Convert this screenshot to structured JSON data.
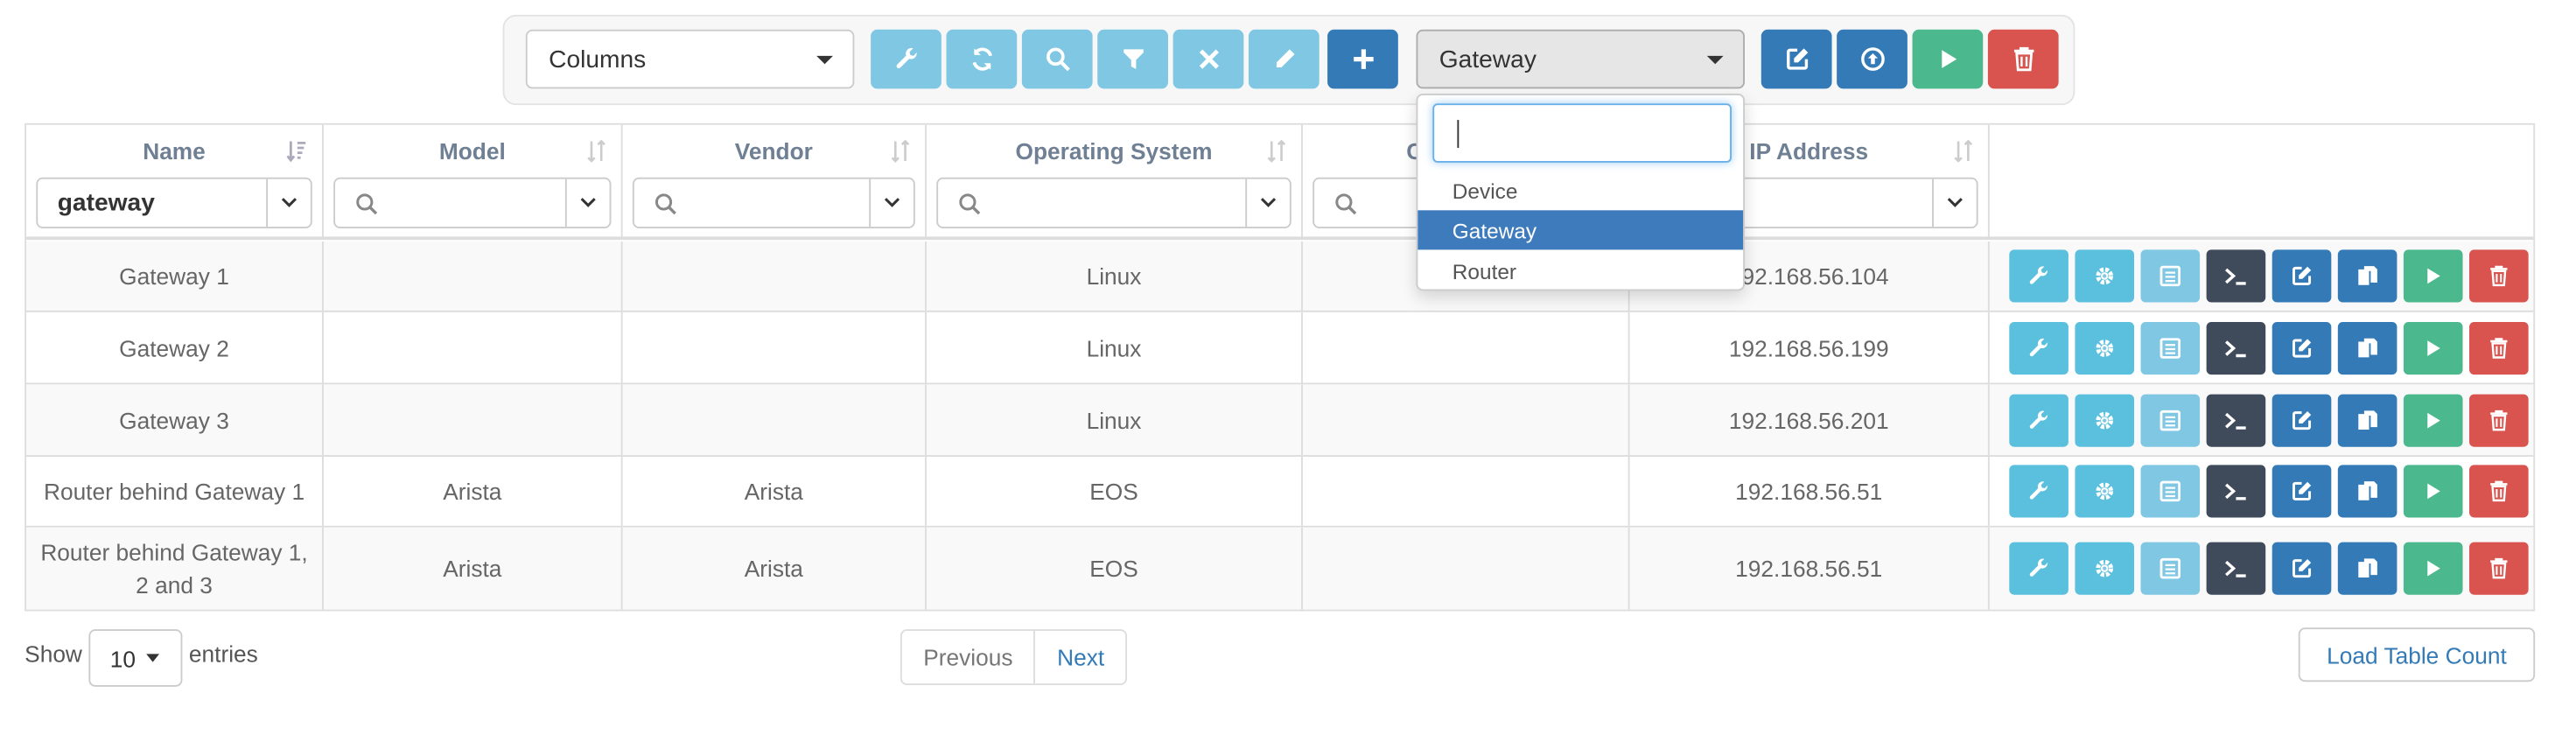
{
  "toolbar": {
    "columns_select": "Columns",
    "type_select": "Gateway",
    "tool_buttons": [
      "wrench-icon",
      "refresh-icon",
      "search-icon",
      "filter-icon",
      "clear-icon",
      "pencil-icon",
      "plus-icon"
    ],
    "action_buttons": [
      "edit-icon",
      "upload-icon",
      "play-icon",
      "trash-icon"
    ]
  },
  "dropdown": {
    "search_value": "",
    "options": [
      "Device",
      "Gateway",
      "Router"
    ],
    "selected": "Gateway"
  },
  "table": {
    "columns": [
      "Name",
      "Model",
      "Vendor",
      "Operating System",
      "C",
      "IP Address"
    ],
    "name_filter": "gateway",
    "rows": [
      {
        "name": "Gateway 1",
        "model": "",
        "vendor": "",
        "os": "Linux",
        "c": "",
        "ip": "192.168.56.104"
      },
      {
        "name": "Gateway 2",
        "model": "",
        "vendor": "",
        "os": "Linux",
        "c": "",
        "ip": "192.168.56.199"
      },
      {
        "name": "Gateway 3",
        "model": "",
        "vendor": "",
        "os": "Linux",
        "c": "",
        "ip": "192.168.56.201"
      },
      {
        "name": "Router behind Gateway 1",
        "model": "Arista",
        "vendor": "Arista",
        "os": "EOS",
        "c": "",
        "ip": "192.168.56.51"
      },
      {
        "name": "Router behind Gateway 1, 2 and 3",
        "model": "Arista",
        "vendor": "Arista",
        "os": "EOS",
        "c": "",
        "ip": "192.168.56.51"
      }
    ],
    "row_actions": [
      "wrench-icon",
      "gear-icon",
      "list-icon",
      "terminal-icon",
      "edit-icon",
      "copy-icon",
      "play-icon",
      "trash-icon"
    ]
  },
  "footer": {
    "show_label": "Show",
    "page_length": "10",
    "entries_label": "entries",
    "previous": "Previous",
    "next": "Next",
    "load_count": "Load Table Count"
  },
  "colors": {
    "info": "#5bc0de",
    "primary": "#337ab7",
    "success": "#4cb88d",
    "danger": "#d9534f",
    "dark": "#3f4b5b",
    "selected_option": "#3e7bbd"
  }
}
